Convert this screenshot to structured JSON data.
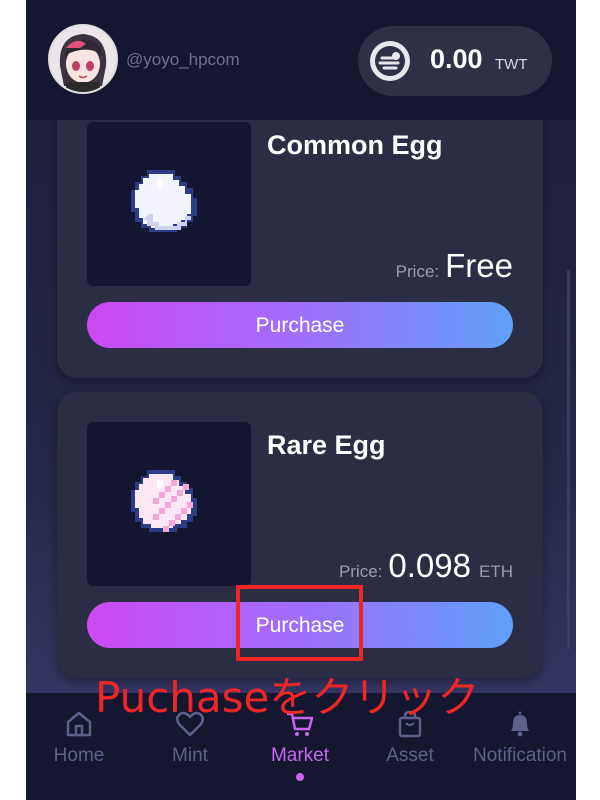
{
  "header": {
    "username": "@yoyo_hpcom",
    "balance": {
      "amount": "0.00",
      "unit": "TWT"
    }
  },
  "products": [
    {
      "title": "Common Egg",
      "price_label": "Price:",
      "price_value": "Free",
      "price_unit": "",
      "button_label": "Purchase"
    },
    {
      "title": "Rare Egg",
      "price_label": "Price:",
      "price_value": "0.098",
      "price_unit": "ETH",
      "button_label": "Purchase"
    }
  ],
  "tabbar": {
    "items": [
      {
        "label": "Home",
        "icon": "home-icon"
      },
      {
        "label": "Mint",
        "icon": "heart-icon"
      },
      {
        "label": "Market",
        "icon": "cart-icon",
        "active": true
      },
      {
        "label": "Asset",
        "icon": "bag-icon"
      },
      {
        "label": "Notification",
        "icon": "bell-icon"
      }
    ]
  },
  "annotation": {
    "text": "Puchaseをクリック",
    "color": "#ee2626"
  },
  "colors": {
    "accent": "#c866ef",
    "button_start": "#cc49f2",
    "button_end": "#5fa0fa"
  }
}
